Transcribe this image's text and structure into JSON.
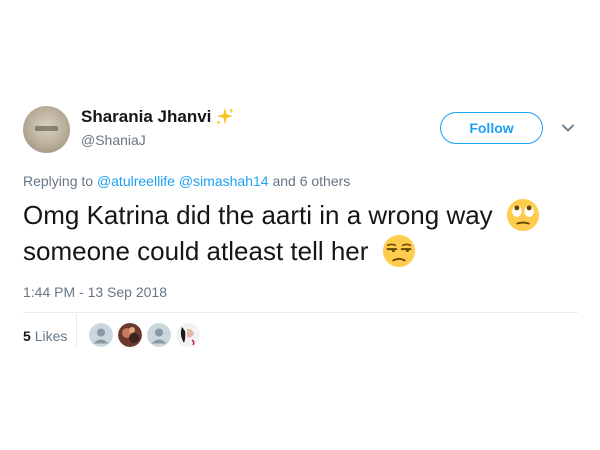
{
  "user": {
    "display_name": "Sharania Jhanvi",
    "handle": "@ShaniaJ"
  },
  "follow_label": "Follow",
  "replying": {
    "prefix": "Replying to",
    "mention_1": "@atulreellife",
    "mention_2": "@simashah14",
    "suffix": "and 6 others"
  },
  "tweet": {
    "line_1": "Omg Katrina did the aarti in a wrong way",
    "line_2": "someone could atleast tell her"
  },
  "timestamp": "1:44 PM - 13 Sep 2018",
  "likes": {
    "count": "5",
    "label": "Likes"
  },
  "icons": {
    "sparkle": "sparkles-icon",
    "chevron": "chevron-down-icon",
    "emoji_1": "face-with-rolling-eyes-emoji",
    "emoji_2": "unamused-face-emoji"
  },
  "colors": {
    "accent": "#1da1f2",
    "secondary_text": "#657786",
    "divider": "#e6ecf0"
  }
}
